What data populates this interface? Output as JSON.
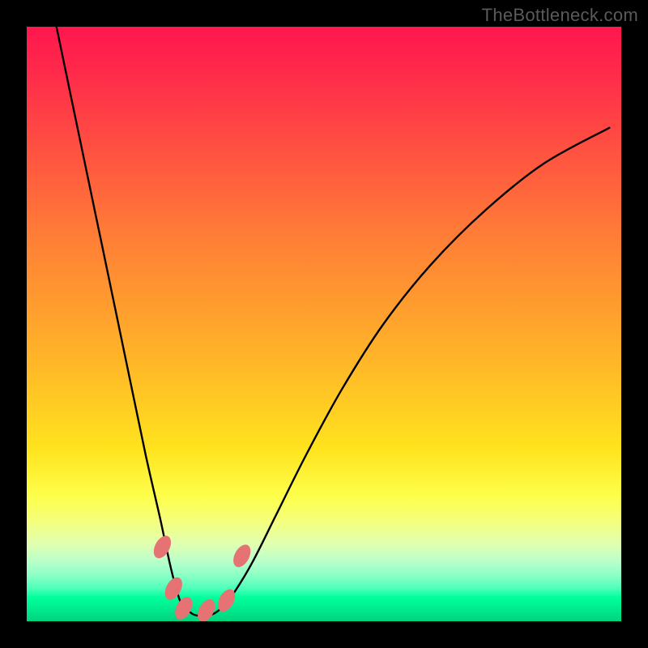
{
  "watermark_text": "TheBottleneck.com",
  "chart_data": {
    "type": "line",
    "title": "",
    "xlabel": "",
    "ylabel": "",
    "xlim": [
      0,
      100
    ],
    "ylim": [
      0,
      100
    ],
    "grid": false,
    "legend": false,
    "series": [
      {
        "name": "bottleneck-curve",
        "x": [
          5,
          7.5,
          10,
          12.5,
          15,
          17.5,
          20,
          22.5,
          24,
          25,
          26,
          27.5,
          28.5,
          30,
          31.5,
          33,
          35,
          38,
          42,
          47,
          53,
          60,
          68,
          77,
          87,
          98
        ],
        "values": [
          100,
          88,
          76,
          64,
          52,
          40,
          28,
          17,
          10,
          6,
          3,
          1.5,
          1,
          1,
          1.3,
          2.5,
          5,
          10,
          18,
          28,
          39,
          50,
          60,
          69,
          77,
          83
        ]
      }
    ],
    "markers": [
      {
        "name": "marker-1",
        "x": 22.8,
        "y": 12.5,
        "color": "#e57373"
      },
      {
        "name": "marker-2",
        "x": 24.7,
        "y": 5.5,
        "color": "#e57373"
      },
      {
        "name": "marker-3",
        "x": 26.4,
        "y": 2.2,
        "color": "#e57373"
      },
      {
        "name": "marker-4",
        "x": 30.2,
        "y": 1.8,
        "color": "#e57373"
      },
      {
        "name": "marker-5",
        "x": 33.6,
        "y": 3.5,
        "color": "#e57373"
      },
      {
        "name": "marker-6",
        "x": 36.2,
        "y": 11.0,
        "color": "#e57373"
      }
    ],
    "marker_style": {
      "rx": 9,
      "ry": 15,
      "rotation_deg": 28
    }
  }
}
